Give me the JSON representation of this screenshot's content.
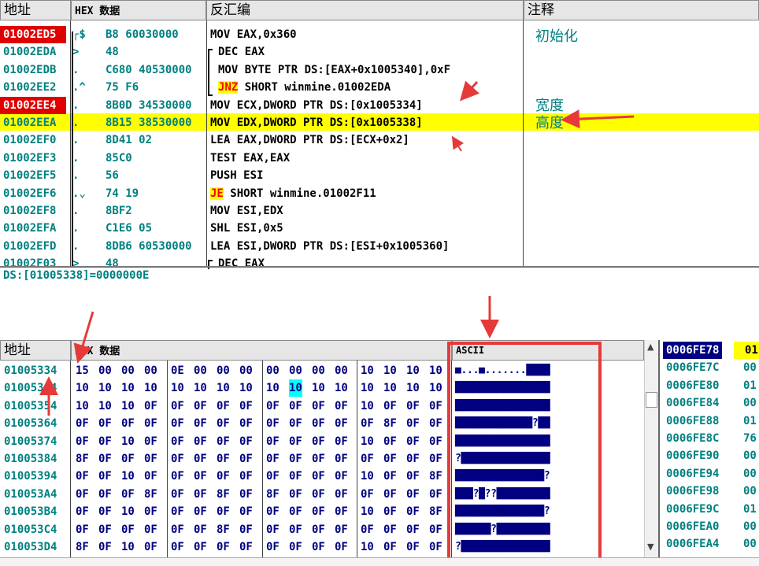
{
  "disasm_headers": {
    "addr": "地址",
    "hex": "HEX 数据",
    "disasm": "反汇编",
    "comment": "注释"
  },
  "disasm_rows": [
    {
      "addr": "01002ED5",
      "mark": "┌$",
      "hex": "B8 60030000",
      "asm": "MOV EAX,0x360",
      "red": true
    },
    {
      "addr": "01002EDA",
      "mark": ">",
      "hex": "48",
      "asm": "DEC EAX"
    },
    {
      "addr": "01002EDB",
      "mark": ".",
      "hex": "C680 40530000",
      "asm": "MOV BYTE PTR DS:[EAX+0x1005340],0xF"
    },
    {
      "addr": "01002EE2",
      "mark": ".^",
      "hex": "75 F6",
      "asm_kw": "JNZ",
      "asm": " SHORT winmine.01002EDA"
    },
    {
      "addr": "01002EE4",
      "mark": ".",
      "hex": "8B0D 34530000",
      "asm": "MOV ECX,DWORD PTR DS:[0x1005334]",
      "red": true
    },
    {
      "addr": "01002EEA",
      "mark": ".",
      "hex": "8B15 38530000",
      "asm": "MOV EDX,DWORD PTR DS:[0x1005338]"
    },
    {
      "addr": "01002EF0",
      "mark": ".",
      "hex": "8D41 02",
      "asm": "LEA EAX,DWORD PTR DS:[ECX+0x2]"
    },
    {
      "addr": "01002EF3",
      "mark": ".",
      "hex": "85C0",
      "asm": "TEST EAX,EAX"
    },
    {
      "addr": "01002EF5",
      "mark": ".",
      "hex": "56",
      "asm": "PUSH ESI"
    },
    {
      "addr": "01002EF6",
      "mark": ".⌄",
      "hex": "74 19",
      "asm_kw": "JE",
      "asm": " SHORT winmine.01002F11"
    },
    {
      "addr": "01002EF8",
      "mark": ".",
      "hex": "8BF2",
      "asm": "MOV ESI,EDX"
    },
    {
      "addr": "01002EFA",
      "mark": ".",
      "hex": "C1E6 05",
      "asm": "SHL ESI,0x5"
    },
    {
      "addr": "01002EFD",
      "mark": ".",
      "hex": "8DB6 60530000",
      "asm": "LEA ESI,DWORD PTR DS:[ESI+0x1005360]"
    },
    {
      "addr": "01002F03",
      "mark": ">",
      "hex": "48",
      "asm": "DEC EAX"
    }
  ],
  "comments": {
    "init": "初始化",
    "width": "宽度",
    "height": "高度"
  },
  "info_line": "DS:[01005338]=0000000E",
  "dump_headers": {
    "addr": "地址",
    "hex": "HEX 数据",
    "ascii": "ASCII"
  },
  "dump_rows": [
    {
      "addr": "01005334",
      "bytes": [
        "15",
        "00",
        "00",
        "00",
        "0E",
        "00",
        "00",
        "00",
        "00",
        "00",
        "00",
        "00",
        "10",
        "10",
        "10",
        "10"
      ],
      "ascii": "■...■.......████"
    },
    {
      "addr": "01005344",
      "bytes": [
        "10",
        "10",
        "10",
        "10",
        "10",
        "10",
        "10",
        "10",
        "10",
        "10",
        "10",
        "10",
        "10",
        "10",
        "10",
        "10"
      ],
      "ascii": "████████████████"
    },
    {
      "addr": "01005354",
      "bytes": [
        "10",
        "10",
        "10",
        "0F",
        "0F",
        "0F",
        "0F",
        "0F",
        "0F",
        "0F",
        "0F",
        "0F",
        "10",
        "0F",
        "0F",
        "0F"
      ],
      "ascii": "████████████████"
    },
    {
      "addr": "01005364",
      "bytes": [
        "0F",
        "0F",
        "0F",
        "0F",
        "0F",
        "0F",
        "0F",
        "0F",
        "0F",
        "0F",
        "0F",
        "0F",
        "0F",
        "8F",
        "0F",
        "0F"
      ],
      "ascii": "█████████████?██"
    },
    {
      "addr": "01005374",
      "bytes": [
        "0F",
        "0F",
        "10",
        "0F",
        "0F",
        "0F",
        "0F",
        "0F",
        "0F",
        "0F",
        "0F",
        "0F",
        "10",
        "0F",
        "0F",
        "0F"
      ],
      "ascii": "████████████████"
    },
    {
      "addr": "01005384",
      "bytes": [
        "8F",
        "0F",
        "0F",
        "0F",
        "0F",
        "0F",
        "0F",
        "0F",
        "0F",
        "0F",
        "0F",
        "0F",
        "0F",
        "0F",
        "0F",
        "0F"
      ],
      "ascii": "?███████████████"
    },
    {
      "addr": "01005394",
      "bytes": [
        "0F",
        "0F",
        "10",
        "0F",
        "0F",
        "0F",
        "0F",
        "0F",
        "0F",
        "0F",
        "0F",
        "0F",
        "10",
        "0F",
        "0F",
        "8F"
      ],
      "ascii": "███████████████?"
    },
    {
      "addr": "010053A4",
      "bytes": [
        "0F",
        "0F",
        "0F",
        "8F",
        "0F",
        "0F",
        "8F",
        "0F",
        "8F",
        "0F",
        "0F",
        "0F",
        "0F",
        "0F",
        "0F",
        "0F"
      ],
      "ascii": "███?█??█████████"
    },
    {
      "addr": "010053B4",
      "bytes": [
        "0F",
        "0F",
        "10",
        "0F",
        "0F",
        "0F",
        "0F",
        "0F",
        "0F",
        "0F",
        "0F",
        "0F",
        "10",
        "0F",
        "0F",
        "8F"
      ],
      "ascii": "███████████████?"
    },
    {
      "addr": "010053C4",
      "bytes": [
        "0F",
        "0F",
        "0F",
        "0F",
        "0F",
        "0F",
        "8F",
        "0F",
        "0F",
        "0F",
        "0F",
        "0F",
        "0F",
        "0F",
        "0F",
        "0F"
      ],
      "ascii": "██████?█████████"
    },
    {
      "addr": "010053D4",
      "bytes": [
        "8F",
        "0F",
        "10",
        "0F",
        "0F",
        "0F",
        "0F",
        "0F",
        "0F",
        "0F",
        "0F",
        "0F",
        "10",
        "0F",
        "0F",
        "0F"
      ],
      "ascii": "?███████████████"
    }
  ],
  "stack_rows": [
    {
      "addr": "0006FE78",
      "val": "01"
    },
    {
      "addr": "0006FE7C",
      "val": "00"
    },
    {
      "addr": "0006FE80",
      "val": "01"
    },
    {
      "addr": "0006FE84",
      "val": "00"
    },
    {
      "addr": "0006FE88",
      "val": "01"
    },
    {
      "addr": "0006FE8C",
      "val": "76"
    },
    {
      "addr": "0006FE90",
      "val": "00"
    },
    {
      "addr": "0006FE94",
      "val": "00"
    },
    {
      "addr": "0006FE98",
      "val": "00"
    },
    {
      "addr": "0006FE9C",
      "val": "01"
    },
    {
      "addr": "0006FEA0",
      "val": "00"
    },
    {
      "addr": "0006FEA4",
      "val": "00"
    }
  ],
  "scroll": {
    "up": "▲",
    "down": "▼"
  },
  "colors": {
    "highlight": "#ffff00",
    "red": "#e00000",
    "teal": "#008080",
    "navy": "#000080",
    "arrow": "#e63a3a"
  }
}
